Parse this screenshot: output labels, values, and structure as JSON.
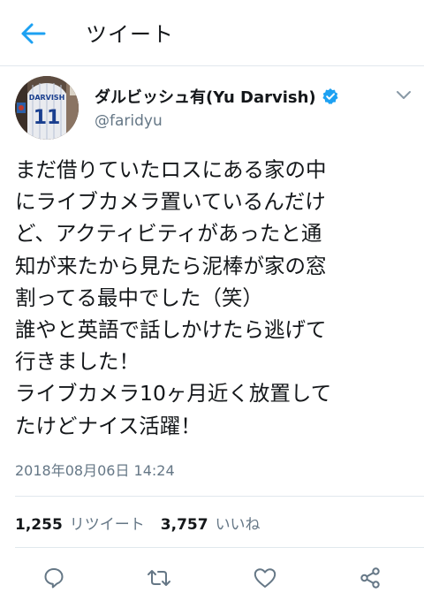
{
  "header": {
    "title": "ツイート",
    "back_icon": "arrow-left-icon",
    "accent_color": "#1da1f2"
  },
  "tweet": {
    "display_name": "ダルビッシュ有(Yu Darvish)",
    "handle": "@faridyu",
    "verified": true,
    "verified_icon": "verified-badge-icon",
    "avatar_jersey_text": "DARVISH",
    "avatar_jersey_number": "11",
    "text": "まだ借りていたロスにある家の中\nにライブカメラ置いているんだけ\nど、アクティビティがあったと通\n知が来たから見たら泥棒が家の窓\n割ってる最中でした（笑）\n誰やと英語で話しかけたら逃げて\n行きました！\nライブカメラ10ヶ月近く放置して\nたけどナイス活躍！",
    "timestamp": "2018年08月06日 14:24"
  },
  "stats": {
    "retweets_count": "1,255",
    "retweets_label": "リツイート",
    "likes_count": "3,757",
    "likes_label": "いいね"
  },
  "actions": [
    {
      "name": "reply",
      "icon": "reply-icon"
    },
    {
      "name": "retweet",
      "icon": "retweet-icon"
    },
    {
      "name": "like",
      "icon": "heart-icon"
    },
    {
      "name": "share",
      "icon": "share-icon"
    }
  ],
  "colors": {
    "text": "#14171a",
    "secondary": "#657786",
    "divider": "#e1e8ed",
    "icon": "#657786"
  }
}
